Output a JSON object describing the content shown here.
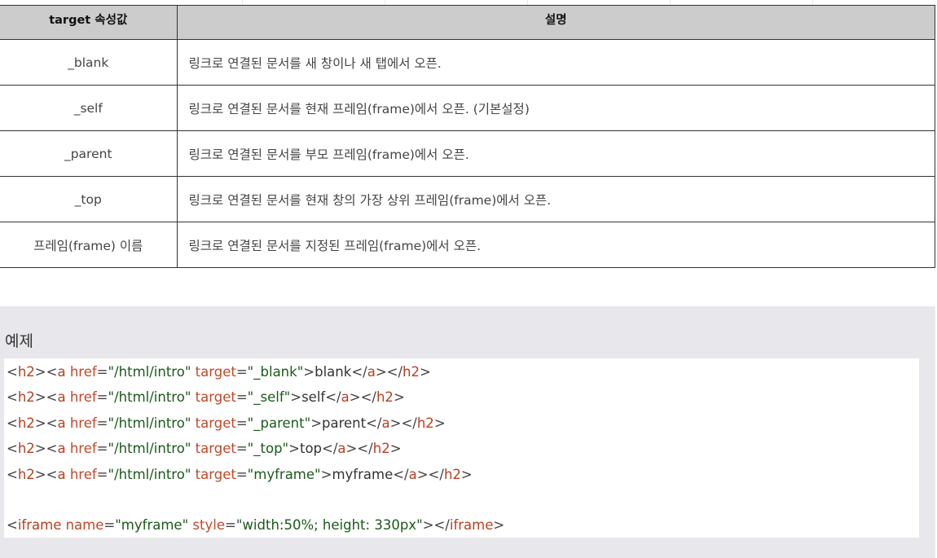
{
  "table": {
    "headers": [
      "target 속성값",
      "설명"
    ],
    "rows": [
      {
        "value": "_blank",
        "description": "링크로 연결된 문서를 새 창이나 새 탭에서 오픈."
      },
      {
        "value": "_self",
        "description": "링크로 연결된 문서를 현재 프레임(frame)에서 오픈. (기본설정)"
      },
      {
        "value": "_parent",
        "description": "링크로 연결된 문서를 부모 프레임(frame)에서 오픈."
      },
      {
        "value": "_top",
        "description": "링크로 연결된 문서를 현재 창의 가장 상위 프레임(frame)에서 오픈."
      },
      {
        "value": "프레임(frame) 이름",
        "description": "링크로 연결된 문서를 지정된 프레임(frame)에서 오픈."
      }
    ]
  },
  "example": {
    "title": "예제",
    "code_lines": [
      {
        "tokens": [
          {
            "t": "br",
            "v": "<"
          },
          {
            "t": "tag",
            "v": "h2"
          },
          {
            "t": "br",
            "v": "><"
          },
          {
            "t": "tag",
            "v": "a"
          },
          {
            "t": "txt",
            "v": " "
          },
          {
            "t": "attr",
            "v": "href"
          },
          {
            "t": "br",
            "v": "="
          },
          {
            "t": "val",
            "v": "\"/html/intro\""
          },
          {
            "t": "txt",
            "v": " "
          },
          {
            "t": "attr",
            "v": "target"
          },
          {
            "t": "br",
            "v": "="
          },
          {
            "t": "val",
            "v": "\"_blank\""
          },
          {
            "t": "br",
            "v": ">"
          },
          {
            "t": "txt",
            "v": "blank"
          },
          {
            "t": "br",
            "v": "</"
          },
          {
            "t": "tag",
            "v": "a"
          },
          {
            "t": "br",
            "v": "></"
          },
          {
            "t": "tag",
            "v": "h2"
          },
          {
            "t": "br",
            "v": ">"
          }
        ]
      },
      {
        "tokens": [
          {
            "t": "br",
            "v": "<"
          },
          {
            "t": "tag",
            "v": "h2"
          },
          {
            "t": "br",
            "v": "><"
          },
          {
            "t": "tag",
            "v": "a"
          },
          {
            "t": "txt",
            "v": " "
          },
          {
            "t": "attr",
            "v": "href"
          },
          {
            "t": "br",
            "v": "="
          },
          {
            "t": "val",
            "v": "\"/html/intro\""
          },
          {
            "t": "txt",
            "v": " "
          },
          {
            "t": "attr",
            "v": "target"
          },
          {
            "t": "br",
            "v": "="
          },
          {
            "t": "val",
            "v": "\"_self\""
          },
          {
            "t": "br",
            "v": ">"
          },
          {
            "t": "txt",
            "v": "self"
          },
          {
            "t": "br",
            "v": "</"
          },
          {
            "t": "tag",
            "v": "a"
          },
          {
            "t": "br",
            "v": "></"
          },
          {
            "t": "tag",
            "v": "h2"
          },
          {
            "t": "br",
            "v": ">"
          }
        ]
      },
      {
        "tokens": [
          {
            "t": "br",
            "v": "<"
          },
          {
            "t": "tag",
            "v": "h2"
          },
          {
            "t": "br",
            "v": "><"
          },
          {
            "t": "tag",
            "v": "a"
          },
          {
            "t": "txt",
            "v": " "
          },
          {
            "t": "attr",
            "v": "href"
          },
          {
            "t": "br",
            "v": "="
          },
          {
            "t": "val",
            "v": "\"/html/intro\""
          },
          {
            "t": "txt",
            "v": " "
          },
          {
            "t": "attr",
            "v": "target"
          },
          {
            "t": "br",
            "v": "="
          },
          {
            "t": "val",
            "v": "\"_parent\""
          },
          {
            "t": "br",
            "v": ">"
          },
          {
            "t": "txt",
            "v": "parent"
          },
          {
            "t": "br",
            "v": "</"
          },
          {
            "t": "tag",
            "v": "a"
          },
          {
            "t": "br",
            "v": "></"
          },
          {
            "t": "tag",
            "v": "h2"
          },
          {
            "t": "br",
            "v": ">"
          }
        ]
      },
      {
        "tokens": [
          {
            "t": "br",
            "v": "<"
          },
          {
            "t": "tag",
            "v": "h2"
          },
          {
            "t": "br",
            "v": "><"
          },
          {
            "t": "tag",
            "v": "a"
          },
          {
            "t": "txt",
            "v": " "
          },
          {
            "t": "attr",
            "v": "href"
          },
          {
            "t": "br",
            "v": "="
          },
          {
            "t": "val",
            "v": "\"/html/intro\""
          },
          {
            "t": "txt",
            "v": " "
          },
          {
            "t": "attr",
            "v": "target"
          },
          {
            "t": "br",
            "v": "="
          },
          {
            "t": "val",
            "v": "\"_top\""
          },
          {
            "t": "br",
            "v": ">"
          },
          {
            "t": "txt",
            "v": "top"
          },
          {
            "t": "br",
            "v": "</"
          },
          {
            "t": "tag",
            "v": "a"
          },
          {
            "t": "br",
            "v": "></"
          },
          {
            "t": "tag",
            "v": "h2"
          },
          {
            "t": "br",
            "v": ">"
          }
        ]
      },
      {
        "tokens": [
          {
            "t": "br",
            "v": "<"
          },
          {
            "t": "tag",
            "v": "h2"
          },
          {
            "t": "br",
            "v": "><"
          },
          {
            "t": "tag",
            "v": "a"
          },
          {
            "t": "txt",
            "v": " "
          },
          {
            "t": "attr",
            "v": "href"
          },
          {
            "t": "br",
            "v": "="
          },
          {
            "t": "val",
            "v": "\"/html/intro\""
          },
          {
            "t": "txt",
            "v": " "
          },
          {
            "t": "attr",
            "v": "target"
          },
          {
            "t": "br",
            "v": "="
          },
          {
            "t": "val",
            "v": "\"myframe\""
          },
          {
            "t": "br",
            "v": ">"
          },
          {
            "t": "txt",
            "v": "myframe"
          },
          {
            "t": "br",
            "v": "</"
          },
          {
            "t": "tag",
            "v": "a"
          },
          {
            "t": "br",
            "v": "></"
          },
          {
            "t": "tag",
            "v": "h2"
          },
          {
            "t": "br",
            "v": ">"
          }
        ]
      },
      {
        "tokens": [
          {
            "t": "br",
            "v": "<"
          },
          {
            "t": "tag",
            "v": "iframe"
          },
          {
            "t": "txt",
            "v": " "
          },
          {
            "t": "attr",
            "v": "name"
          },
          {
            "t": "br",
            "v": "="
          },
          {
            "t": "val",
            "v": "\"myframe\""
          },
          {
            "t": "txt",
            "v": " "
          },
          {
            "t": "attr",
            "v": "style"
          },
          {
            "t": "br",
            "v": "="
          },
          {
            "t": "val",
            "v": "\"width:50%; height: 330px\""
          },
          {
            "t": "br",
            "v": "></"
          },
          {
            "t": "tag",
            "v": "iframe"
          },
          {
            "t": "br",
            "v": ">"
          }
        ]
      }
    ]
  }
}
